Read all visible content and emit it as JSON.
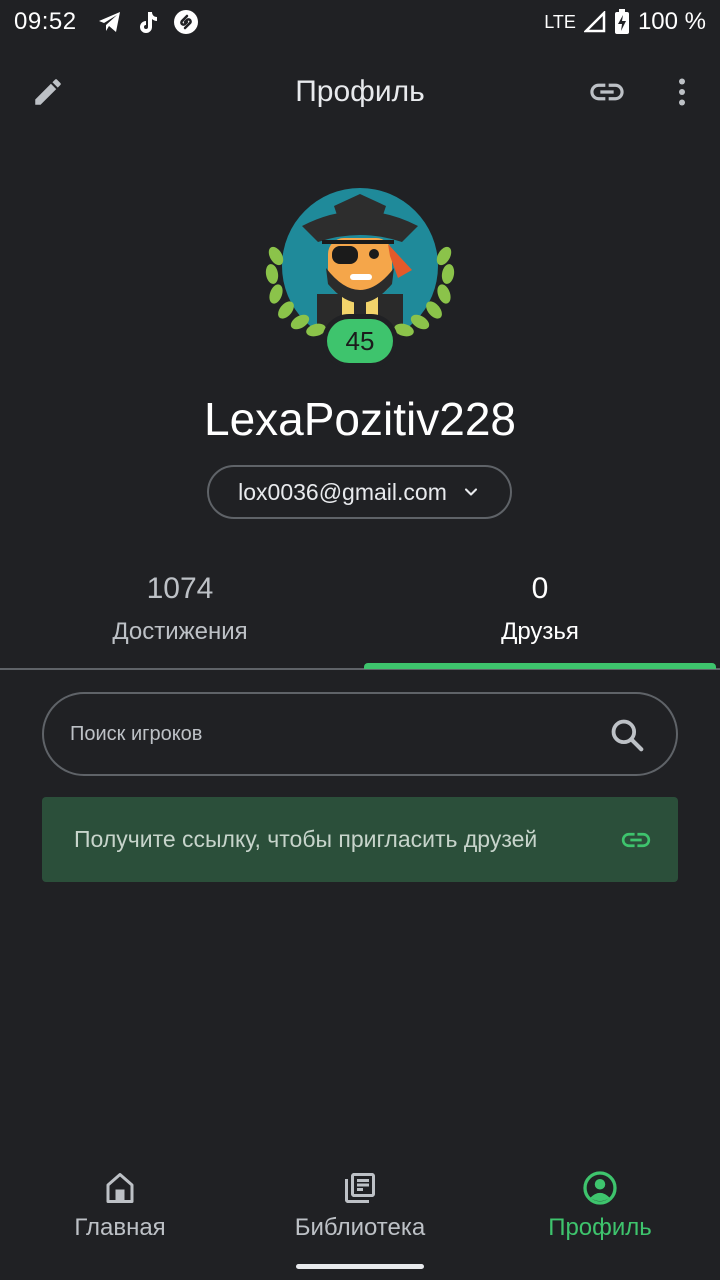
{
  "status_bar": {
    "time": "09:52",
    "network": "LTE",
    "battery": "100 %",
    "app_icons": [
      "telegram-icon",
      "tiktok-icon",
      "shazam-icon"
    ]
  },
  "app_bar": {
    "title": "Профиль"
  },
  "profile": {
    "level": "45",
    "username": "LexaPozitiv228",
    "account_email": "lox0036@gmail.com"
  },
  "tabs": [
    {
      "count": "1074",
      "label": "Достижения",
      "active": false
    },
    {
      "count": "0",
      "label": "Друзья",
      "active": true
    }
  ],
  "search": {
    "placeholder": "Поиск игроков"
  },
  "invite": {
    "text": "Получите ссылку, чтобы пригласить друзей"
  },
  "bottom_nav": [
    {
      "label": "Главная",
      "icon": "home-icon",
      "active": false
    },
    {
      "label": "Библиотека",
      "icon": "library-icon",
      "active": false
    },
    {
      "label": "Профиль",
      "icon": "profile-icon",
      "active": true
    }
  ],
  "colors": {
    "background": "#202124",
    "accent": "#3ec46d",
    "invite_card": "#2b4f3a"
  }
}
